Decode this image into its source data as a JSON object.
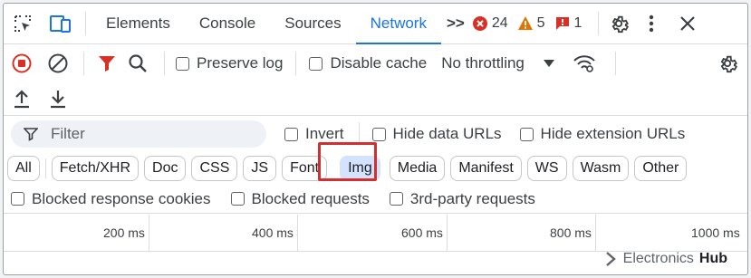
{
  "tabs": [
    {
      "label": "Elements",
      "active": false
    },
    {
      "label": "Console",
      "active": false
    },
    {
      "label": "Sources",
      "active": false
    },
    {
      "label": "Network",
      "active": true
    }
  ],
  "status": {
    "more": ">>",
    "errors": "24",
    "warnings": "5",
    "issues": "1"
  },
  "toolbar": {
    "preserve_log": "Preserve log",
    "disable_cache": "Disable cache",
    "throttling": "No throttling"
  },
  "filter": {
    "placeholder": "Filter",
    "invert": "Invert",
    "hide_data_urls": "Hide data URLs",
    "hide_extension_urls": "Hide extension URLs"
  },
  "types": [
    {
      "label": "All",
      "selected": false
    },
    {
      "label": "Fetch/XHR",
      "selected": false
    },
    {
      "label": "Doc",
      "selected": false
    },
    {
      "label": "CSS",
      "selected": false
    },
    {
      "label": "JS",
      "selected": false
    },
    {
      "label": "Font",
      "selected": false
    },
    {
      "label": "Img",
      "selected": true
    },
    {
      "label": "Media",
      "selected": false
    },
    {
      "label": "Manifest",
      "selected": false
    },
    {
      "label": "WS",
      "selected": false
    },
    {
      "label": "Wasm",
      "selected": false
    },
    {
      "label": "Other",
      "selected": false
    }
  ],
  "blocked": {
    "cookies": "Blocked response cookies",
    "requests": "Blocked requests",
    "third_party": "3rd-party requests"
  },
  "timeline": [
    "200 ms",
    "400 ms",
    "600 ms",
    "800 ms",
    "1000 ms"
  ],
  "watermark": {
    "brand": "Electronics",
    "brand_bold": "Hub"
  },
  "colors": {
    "accent": "#1a73e8",
    "record": "#d93025",
    "filter_funnel": "#d93025",
    "highlight": "#d32f2f",
    "selected_chip": "#d3e3fd"
  }
}
